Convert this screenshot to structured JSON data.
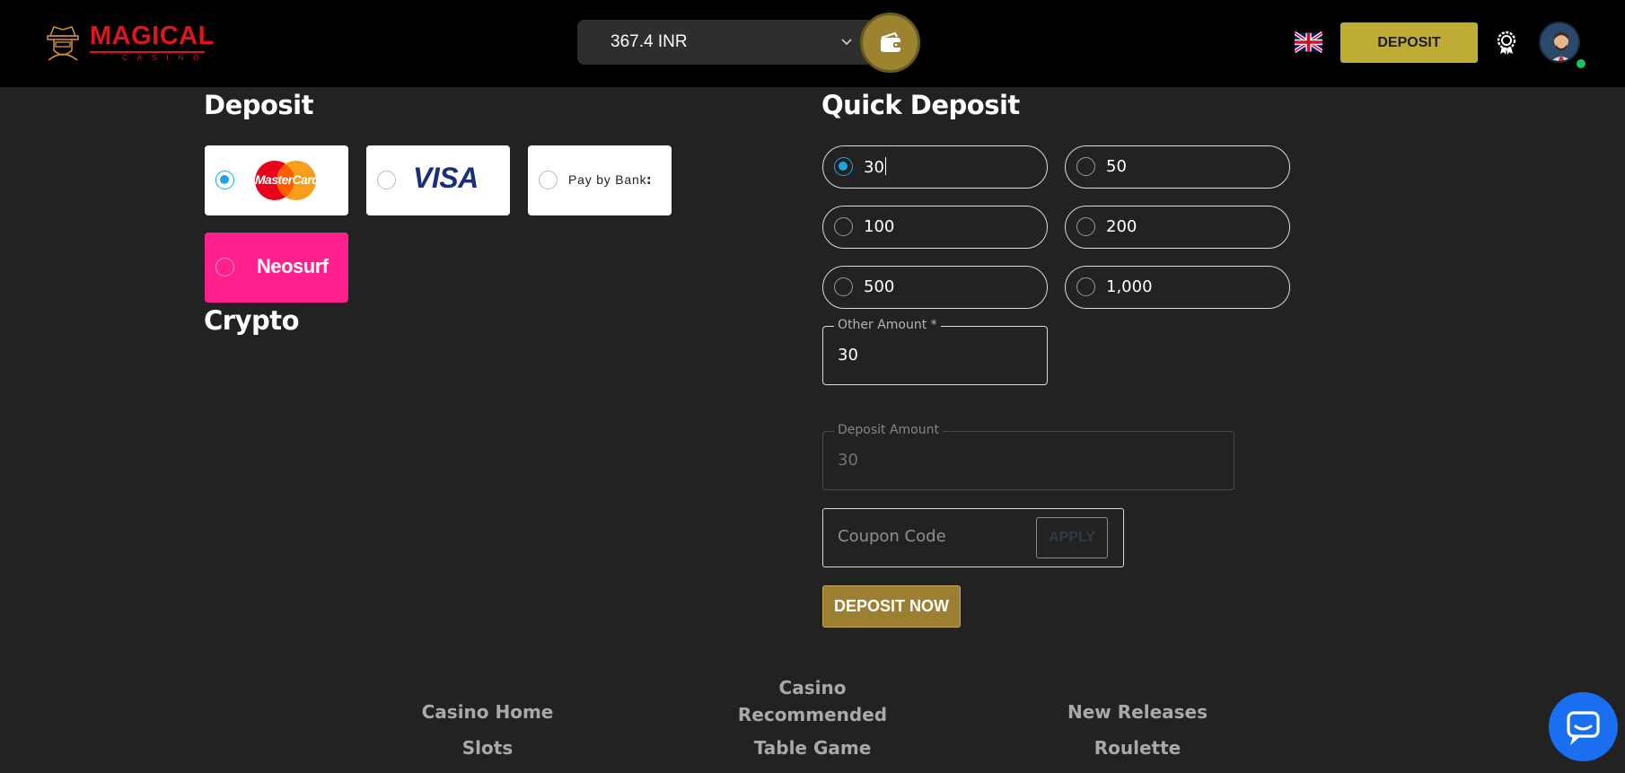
{
  "header": {
    "logo": {
      "name": "MAGICAL",
      "sub": "CASINO"
    },
    "balance": "367.4 INR",
    "deposit_button": "DEPOSIT",
    "language": "English (UK flag)"
  },
  "deposit_section": {
    "title": "Deposit",
    "methods": [
      {
        "name": "MasterCard",
        "selected": true
      },
      {
        "name": "VISA",
        "selected": false
      },
      {
        "name": "Pay by Bank",
        "selected": false
      },
      {
        "name": "Neosurf",
        "selected": false
      }
    ],
    "crypto_title": "Crypto"
  },
  "quick_deposit": {
    "title": "Quick Deposit",
    "amounts": [
      {
        "label": "30",
        "selected": true
      },
      {
        "label": "50",
        "selected": false
      },
      {
        "label": "100",
        "selected": false
      },
      {
        "label": "200",
        "selected": false
      },
      {
        "label": "500",
        "selected": false
      },
      {
        "label": "1,000",
        "selected": false
      }
    ],
    "other_amount": {
      "label": "Other Amount *",
      "value": "30"
    },
    "deposit_amount": {
      "label": "Deposit Amount",
      "value": "30"
    },
    "coupon": {
      "placeholder": "Coupon Code",
      "apply_label": "APPLY"
    },
    "submit_label": "DEPOSIT NOW"
  },
  "footer": {
    "links": [
      "Casino Home",
      "Casino Recommended",
      "New Releases",
      "Slots",
      "Table Game",
      "Roulette"
    ]
  },
  "colors": {
    "background": "#222222",
    "header": "#000000",
    "brand_red": "#e0141b",
    "gold": "#bfac35",
    "accent_blue": "#1ea4e0",
    "neosurf_pink": "#ff1f8d",
    "chat_blue": "#1a6ef0"
  },
  "icons": {
    "wallet": "wallet-icon",
    "award": "award-icon",
    "chat": "chat-icon",
    "chevron": "chevron-down-icon"
  }
}
